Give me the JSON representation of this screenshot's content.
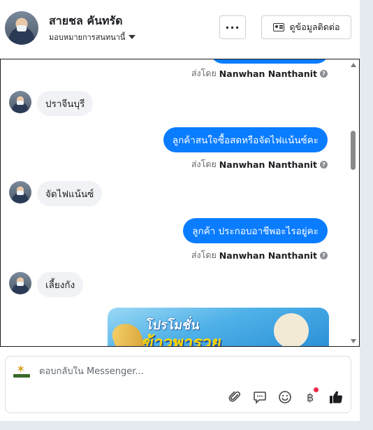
{
  "header": {
    "contact_name": "สายชล คันทรัด",
    "assignee_label": "มอบหมายการสนทนานี้",
    "more_label": "···",
    "contact_info_label": "ดูข้อมูลติดต่อ"
  },
  "messages": [
    {
      "type": "sent_by",
      "prefix": "ส่งโดย",
      "sender": "Nanwhan Nanthanit"
    },
    {
      "type": "incoming",
      "text": "ปราจีนบุรี"
    },
    {
      "type": "outgoing",
      "text": "ลูกค้าสนใจซื้อสดหรือจัดไฟแน้นซ์คะ"
    },
    {
      "type": "sent_by",
      "prefix": "ส่งโดย",
      "sender": "Nanwhan Nanthanit"
    },
    {
      "type": "incoming",
      "text": "จัดไฟแน้นซ์"
    },
    {
      "type": "outgoing",
      "text": "ลูกค้า  ประกอบอาชีพอะไรอยู่คะ"
    },
    {
      "type": "sent_by",
      "prefix": "ส่งโดย",
      "sender": "Nanwhan Nanthanit"
    },
    {
      "type": "incoming",
      "text": "เลี้ยงกัง"
    },
    {
      "type": "image",
      "line1": "โปรโมชั่น",
      "line2": "ข้าวพารวย"
    }
  ],
  "composer": {
    "placeholder": "ตอบกลับใน Messenger..."
  },
  "toolbar": {
    "icons": [
      "paperclip-icon",
      "saved-reply-icon",
      "emoji-icon",
      "baht-payment-icon",
      "thumbs-up-icon"
    ]
  },
  "colors": {
    "outgoing_bubble": "#0a7cff",
    "incoming_bubble": "#f0f2f5",
    "notification_dot": "#f02849"
  }
}
